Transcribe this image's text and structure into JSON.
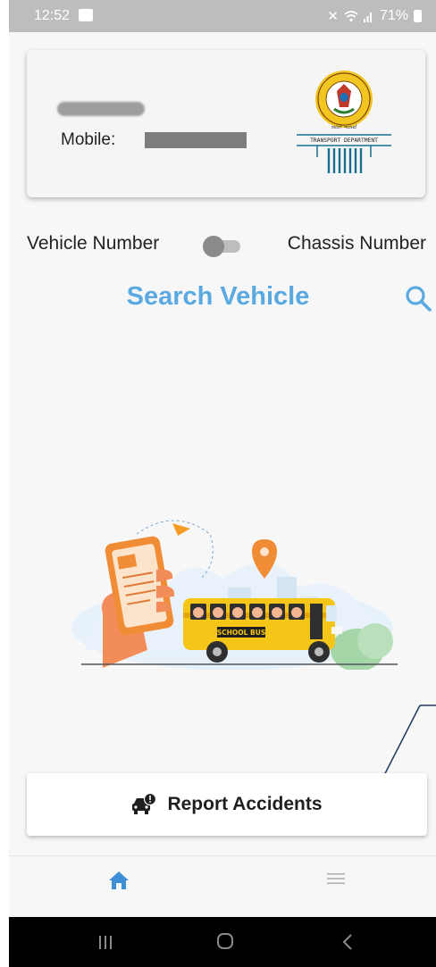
{
  "status_bar": {
    "time": "12:52",
    "battery": "71%",
    "icons": [
      "gallery-icon",
      "mute-icon",
      "wifi-icon",
      "signal-icon",
      "battery-icon"
    ]
  },
  "profile": {
    "mobile_label": "Mobile:",
    "logo_text": "TRANSPORT DEPARTMENT",
    "logo_ring_text": "GOVERNMENT OF KARNATAKA",
    "logo_kannada": "ಸಾರಿಗೆ ಇಲಾಖೆ"
  },
  "toggle": {
    "left_label": "Vehicle Number",
    "right_label": "Chassis Number",
    "state": "off"
  },
  "search": {
    "title": "Search Vehicle",
    "icon": "search-icon"
  },
  "illustration": {
    "bus_label": "SCHOOL BUS"
  },
  "report": {
    "label": "Report Accidents",
    "icon": "car-accident-icon"
  },
  "bottom_nav": {
    "items": [
      {
        "icon": "home-icon",
        "active": true
      },
      {
        "icon": "menu-icon",
        "active": false
      }
    ]
  },
  "colors": {
    "accent": "#5aa9e0",
    "status_bar": "#bdbdbd",
    "background": "#f7f7f8"
  }
}
